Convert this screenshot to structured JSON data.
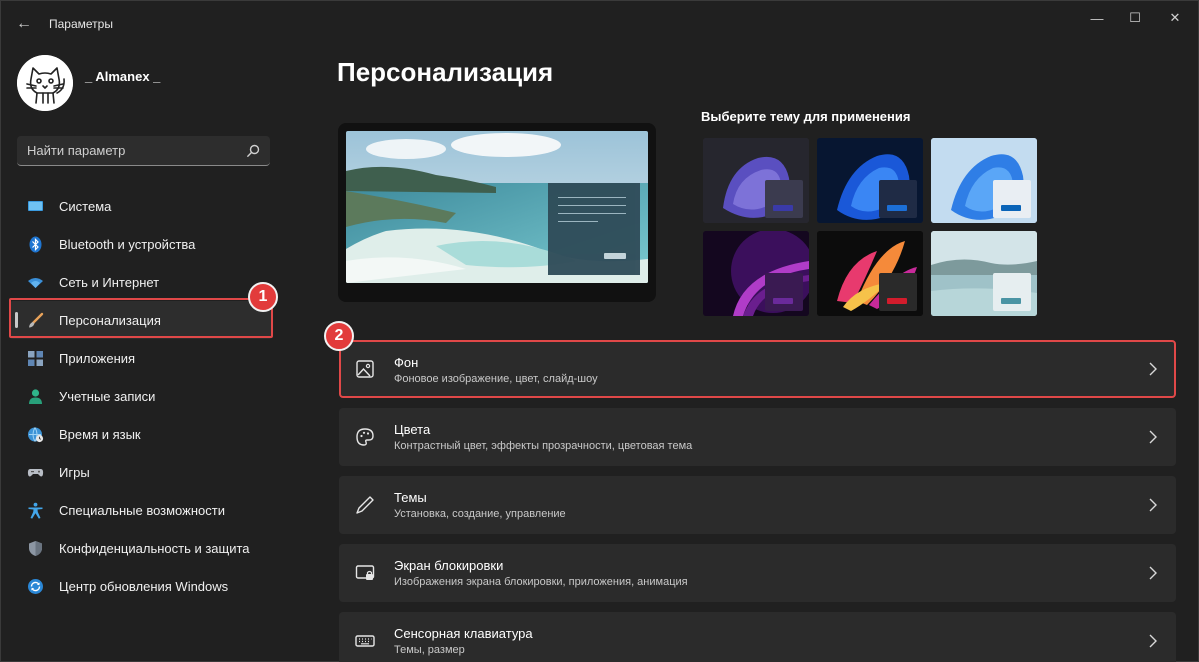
{
  "window": {
    "back_glyph": "←",
    "title": "Параметры",
    "controls": {
      "minimize": "—",
      "maximize": "☐",
      "close": "✕"
    }
  },
  "user": {
    "name": "_ Almanex _",
    "avatar_icon": "cat-avatar-icon"
  },
  "search": {
    "placeholder": "Найти параметр",
    "value": ""
  },
  "sidebar": {
    "items": [
      {
        "label": "Система",
        "icon": "monitor-icon",
        "active": false
      },
      {
        "label": "Bluetooth и устройства",
        "icon": "bluetooth-icon",
        "active": false
      },
      {
        "label": "Сеть и Интернет",
        "icon": "wifi-icon",
        "active": false
      },
      {
        "label": "Персонализация",
        "icon": "brush-icon",
        "active": true
      },
      {
        "label": "Приложения",
        "icon": "apps-icon",
        "active": false
      },
      {
        "label": "Учетные записи",
        "icon": "person-icon",
        "active": false
      },
      {
        "label": "Время и язык",
        "icon": "globe-clock-icon",
        "active": false
      },
      {
        "label": "Игры",
        "icon": "gamepad-icon",
        "active": false
      },
      {
        "label": "Специальные возможности",
        "icon": "accessibility-icon",
        "active": false
      },
      {
        "label": "Конфиденциальность и защита",
        "icon": "shield-icon",
        "active": false
      },
      {
        "label": "Центр обновления Windows",
        "icon": "update-icon",
        "active": false
      }
    ]
  },
  "annotations": {
    "badge_1": "1",
    "badge_2": "2"
  },
  "main": {
    "title": "Персонализация",
    "themes_heading": "Выберите тему для применения",
    "themes": [
      {
        "name": "theme-dark-glow",
        "accent": "#3a3aa8"
      },
      {
        "name": "theme-windows-dark",
        "accent": "#1c6fd6"
      },
      {
        "name": "theme-windows-light",
        "accent": "#0a64b8"
      },
      {
        "name": "theme-purple-captured",
        "accent": "#6a2a9a"
      },
      {
        "name": "theme-flow",
        "accent": "#d21c2c"
      },
      {
        "name": "theme-sunrise",
        "accent": "#4a94a4"
      }
    ],
    "cards": [
      {
        "title": "Фон",
        "subtitle": "Фоновое изображение, цвет, слайд-шоу",
        "icon": "image-icon"
      },
      {
        "title": "Цвета",
        "subtitle": "Контрастный цвет, эффекты прозрачности, цветовая тема",
        "icon": "palette-icon"
      },
      {
        "title": "Темы",
        "subtitle": "Установка, создание, управление",
        "icon": "pen-icon"
      },
      {
        "title": "Экран блокировки",
        "subtitle": "Изображения экрана блокировки, приложения, анимация",
        "icon": "lock-screen-icon"
      },
      {
        "title": "Сенсорная клавиатура",
        "subtitle": "Темы, размер",
        "icon": "keyboard-icon"
      }
    ]
  },
  "colors": {
    "background": "#202020",
    "card": "#2b2b2b",
    "highlight": "#e04848"
  }
}
